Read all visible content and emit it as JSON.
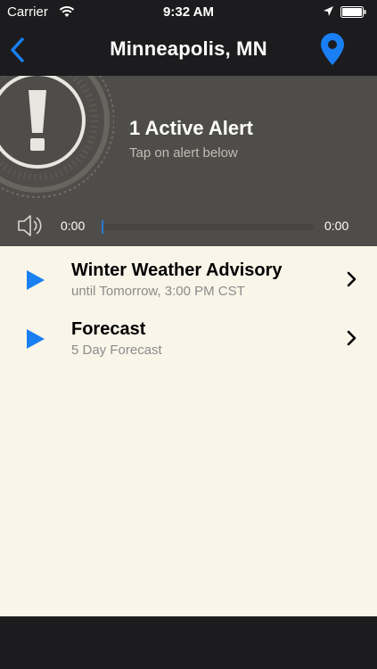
{
  "status_bar": {
    "carrier": "Carrier",
    "time": "9:32 AM"
  },
  "nav": {
    "title": "Minneapolis, MN",
    "back_icon": "chevron-left-icon",
    "location_icon": "map-pin-icon"
  },
  "alert_header": {
    "count_label": "1 Active Alert",
    "hint": "Tap on alert below",
    "audio": {
      "elapsed": "0:00",
      "duration": "0:00",
      "progress": 0
    }
  },
  "items": [
    {
      "title": "Winter Weather Advisory",
      "subtitle": "until Tomorrow, 3:00 PM CST"
    },
    {
      "title": "Forecast",
      "subtitle": "5 Day Forecast"
    }
  ],
  "colors": {
    "accent": "#1a7ff2",
    "header_bg": "#4f4d49",
    "list_bg": "#f9f6e9",
    "bar_bg": "#1c1c1e"
  }
}
